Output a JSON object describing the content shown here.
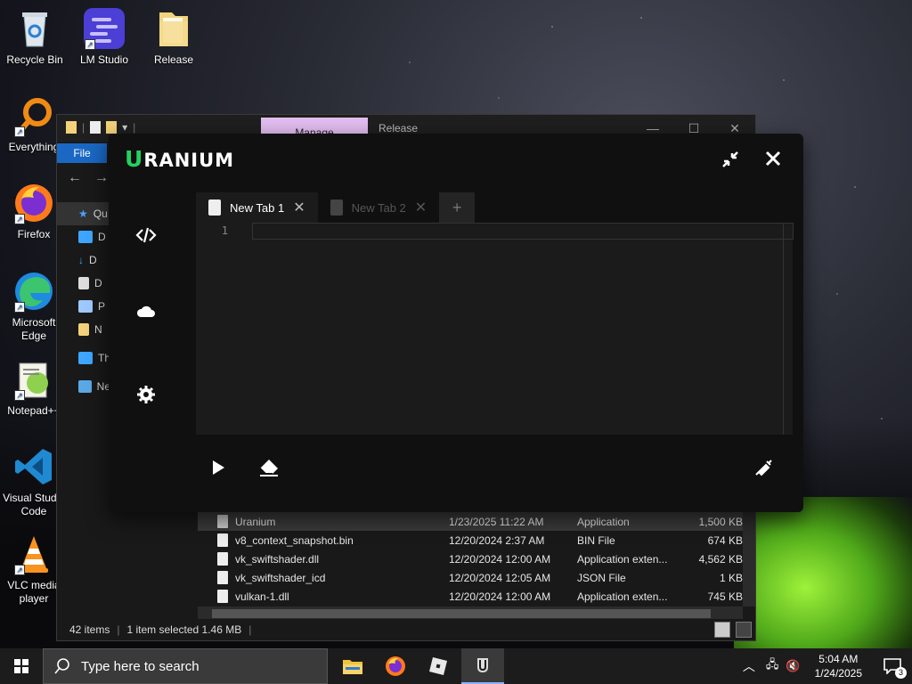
{
  "desktop": {
    "icons": [
      {
        "label": "Recycle Bin",
        "icon": "recycle-bin-icon"
      },
      {
        "label": "LM Studio",
        "icon": "lm-studio-icon"
      },
      {
        "label": "Release",
        "icon": "folder-icon"
      },
      {
        "label": "Everything",
        "icon": "everything-search-icon"
      },
      {
        "label": "Firefox",
        "icon": "firefox-icon"
      },
      {
        "label": "Microsoft Edge",
        "icon": "edge-icon"
      },
      {
        "label": "Notepad++",
        "icon": "notepadpp-icon"
      },
      {
        "label": "Visual Studio Code",
        "icon": "vscode-icon"
      },
      {
        "label": "VLC media player",
        "icon": "vlc-icon"
      }
    ]
  },
  "explorer": {
    "title": "Release",
    "manage_tab": "Manage",
    "file_tab": "File",
    "nav": [
      {
        "label": "Qu",
        "icon": "quick-access-star-icon"
      },
      {
        "label": "D",
        "icon": "desktop-folder-icon"
      },
      {
        "label": "D",
        "icon": "downloads-icon"
      },
      {
        "label": "D",
        "icon": "documents-icon"
      },
      {
        "label": "P",
        "icon": "pictures-icon"
      },
      {
        "label": "N",
        "icon": "folder-icon"
      },
      {
        "label": "Th",
        "icon": "this-pc-icon"
      },
      {
        "label": "Ne",
        "icon": "network-icon"
      }
    ],
    "files": [
      {
        "name": "Uranium",
        "date": "1/23/2025 11:22 AM",
        "type": "Application",
        "size": "1,500 KB"
      },
      {
        "name": "v8_context_snapshot.bin",
        "date": "12/20/2024 2:37 AM",
        "type": "BIN File",
        "size": "674 KB"
      },
      {
        "name": "vk_swiftshader.dll",
        "date": "12/20/2024 12:00 AM",
        "type": "Application exten...",
        "size": "4,562 KB"
      },
      {
        "name": "vk_swiftshader_icd",
        "date": "12/20/2024 12:05 AM",
        "type": "JSON File",
        "size": "1 KB"
      },
      {
        "name": "vulkan-1.dll",
        "date": "12/20/2024 12:00 AM",
        "type": "Application exten...",
        "size": "745 KB"
      }
    ],
    "status": {
      "items": "42 items",
      "selected": "1 item selected  1.46 MB"
    }
  },
  "uranium": {
    "logo_first": "U",
    "logo_rest": "RANIUM",
    "accent": "#23d160",
    "tabs": [
      {
        "label": "New Tab 1",
        "active": true
      },
      {
        "label": "New Tab 2",
        "active": false
      }
    ],
    "add_tab": "+",
    "line_number": "1",
    "sidebar": [
      "code-icon",
      "cloud-icon",
      "settings-gear-icon"
    ]
  },
  "taskbar": {
    "search_placeholder": "Type here to search",
    "time": "5:04 AM",
    "date": "1/24/2025",
    "notification_count": "3"
  }
}
